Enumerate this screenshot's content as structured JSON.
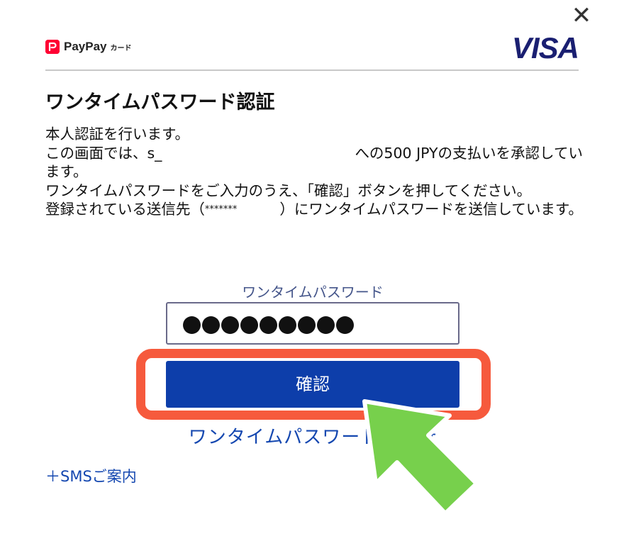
{
  "header": {
    "close_glyph": "✕",
    "paypay_mark": "P",
    "paypay_brand": "PayPay",
    "paypay_card_label": "カード",
    "visa_brand": "VISA"
  },
  "title": "ワンタイムパスワード認証",
  "description": {
    "line1": "本人認証を行います。",
    "line2_start": "この画面では、s_",
    "line2_end": "への500 JPYの支払いを承認しています。",
    "line3": "ワンタイムパスワードをご入力のうえ、「確認」ボタンを押してください。",
    "line4_start": "登録されている送信先（",
    "line4_masked": "*******",
    "line4_end": "）にワンタイムパスワードを送信しています。"
  },
  "otp": {
    "label": "ワンタイムパスワード",
    "dot_count": 9
  },
  "confirm_button": {
    "label": "確認"
  },
  "resend_link": {
    "label": "ワンタイムパスワード再発行"
  },
  "sms_link": {
    "label": "＋SMSご案内"
  },
  "colors": {
    "confirm_button": "#0d3eaa",
    "link": "#1447b0",
    "highlight_ring": "#f65a3d",
    "arrow": "#77d04c",
    "paypay_red": "#ff0033",
    "visa_navy": "#1a1f71"
  },
  "icons": {
    "close": "close-icon",
    "arrow": "pointer-arrow-icon"
  }
}
